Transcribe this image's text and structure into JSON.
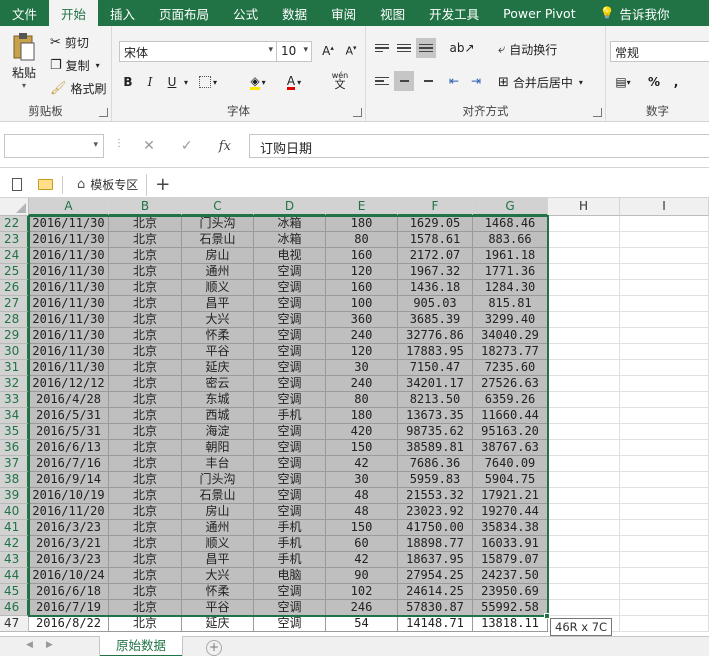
{
  "tabs": [
    {
      "label": "文件"
    },
    {
      "label": "开始",
      "active": true
    },
    {
      "label": "插入"
    },
    {
      "label": "页面布局"
    },
    {
      "label": "公式"
    },
    {
      "label": "数据"
    },
    {
      "label": "审阅"
    },
    {
      "label": "视图"
    },
    {
      "label": "开发工具"
    },
    {
      "label": "Power Pivot"
    },
    {
      "label": "告诉我你"
    }
  ],
  "ribbon": {
    "clipboard": {
      "paste": "粘贴",
      "cut": "剪切",
      "copy": "复制",
      "format_painter": "格式刷",
      "label": "剪贴板"
    },
    "font": {
      "name": "宋体",
      "size": "10",
      "bold": "B",
      "italic": "I",
      "underline": "U",
      "phonetic": "wén",
      "label": "字体"
    },
    "alignment": {
      "wrap": "自动换行",
      "merge": "合并后居中",
      "label": "对齐方式"
    },
    "number": {
      "format": "常规",
      "percent": "%",
      "comma": ",",
      "label": "数字"
    }
  },
  "formula_bar": {
    "name_box": "",
    "content": "订购日期"
  },
  "template_bar": {
    "tab_label": "模板专区"
  },
  "columns": [
    "A",
    "B",
    "C",
    "D",
    "E",
    "F",
    "G",
    "H",
    "I"
  ],
  "rows": [
    {
      "n": "22",
      "a": "2016/11/30",
      "b": "北京",
      "c": "门头沟",
      "d": "冰箱",
      "e": "180",
      "f": "1629.05",
      "g": "1468.46"
    },
    {
      "n": "23",
      "a": "2016/11/30",
      "b": "北京",
      "c": "石景山",
      "d": "冰箱",
      "e": "80",
      "f": "1578.61",
      "g": "883.66"
    },
    {
      "n": "24",
      "a": "2016/11/30",
      "b": "北京",
      "c": "房山",
      "d": "电视",
      "e": "160",
      "f": "2172.07",
      "g": "1961.18"
    },
    {
      "n": "25",
      "a": "2016/11/30",
      "b": "北京",
      "c": "通州",
      "d": "空调",
      "e": "120",
      "f": "1967.32",
      "g": "1771.36"
    },
    {
      "n": "26",
      "a": "2016/11/30",
      "b": "北京",
      "c": "顺义",
      "d": "空调",
      "e": "160",
      "f": "1436.18",
      "g": "1284.30"
    },
    {
      "n": "27",
      "a": "2016/11/30",
      "b": "北京",
      "c": "昌平",
      "d": "空调",
      "e": "100",
      "f": "905.03",
      "g": "815.81"
    },
    {
      "n": "28",
      "a": "2016/11/30",
      "b": "北京",
      "c": "大兴",
      "d": "空调",
      "e": "360",
      "f": "3685.39",
      "g": "3299.40"
    },
    {
      "n": "29",
      "a": "2016/11/30",
      "b": "北京",
      "c": "怀柔",
      "d": "空调",
      "e": "240",
      "f": "32776.86",
      "g": "34040.29"
    },
    {
      "n": "30",
      "a": "2016/11/30",
      "b": "北京",
      "c": "平谷",
      "d": "空调",
      "e": "120",
      "f": "17883.95",
      "g": "18273.77"
    },
    {
      "n": "31",
      "a": "2016/11/30",
      "b": "北京",
      "c": "延庆",
      "d": "空调",
      "e": "30",
      "f": "7150.47",
      "g": "7235.60"
    },
    {
      "n": "32",
      "a": "2016/12/12",
      "b": "北京",
      "c": "密云",
      "d": "空调",
      "e": "240",
      "f": "34201.17",
      "g": "27526.63"
    },
    {
      "n": "33",
      "a": "2016/4/28",
      "b": "北京",
      "c": "东城",
      "d": "空调",
      "e": "80",
      "f": "8213.50",
      "g": "6359.26"
    },
    {
      "n": "34",
      "a": "2016/5/31",
      "b": "北京",
      "c": "西城",
      "d": "手机",
      "e": "180",
      "f": "13673.35",
      "g": "11660.44"
    },
    {
      "n": "35",
      "a": "2016/5/31",
      "b": "北京",
      "c": "海淀",
      "d": "空调",
      "e": "420",
      "f": "98735.62",
      "g": "95163.20"
    },
    {
      "n": "36",
      "a": "2016/6/13",
      "b": "北京",
      "c": "朝阳",
      "d": "空调",
      "e": "150",
      "f": "38589.81",
      "g": "38767.63"
    },
    {
      "n": "37",
      "a": "2016/7/16",
      "b": "北京",
      "c": "丰台",
      "d": "空调",
      "e": "42",
      "f": "7686.36",
      "g": "7640.09"
    },
    {
      "n": "38",
      "a": "2016/9/14",
      "b": "北京",
      "c": "门头沟",
      "d": "空调",
      "e": "30",
      "f": "5959.83",
      "g": "5904.75"
    },
    {
      "n": "39",
      "a": "2016/10/19",
      "b": "北京",
      "c": "石景山",
      "d": "空调",
      "e": "48",
      "f": "21553.32",
      "g": "17921.21"
    },
    {
      "n": "40",
      "a": "2016/11/20",
      "b": "北京",
      "c": "房山",
      "d": "空调",
      "e": "48",
      "f": "23023.92",
      "g": "19270.44"
    },
    {
      "n": "41",
      "a": "2016/3/23",
      "b": "北京",
      "c": "通州",
      "d": "手机",
      "e": "150",
      "f": "41750.00",
      "g": "35834.38"
    },
    {
      "n": "42",
      "a": "2016/3/21",
      "b": "北京",
      "c": "顺义",
      "d": "手机",
      "e": "60",
      "f": "18898.77",
      "g": "16033.91"
    },
    {
      "n": "43",
      "a": "2016/3/23",
      "b": "北京",
      "c": "昌平",
      "d": "手机",
      "e": "42",
      "f": "18637.95",
      "g": "15879.07"
    },
    {
      "n": "44",
      "a": "2016/10/24",
      "b": "北京",
      "c": "大兴",
      "d": "电脑",
      "e": "90",
      "f": "27954.25",
      "g": "24237.50"
    },
    {
      "n": "45",
      "a": "2016/6/18",
      "b": "北京",
      "c": "怀柔",
      "d": "空调",
      "e": "102",
      "f": "24614.25",
      "g": "23950.69"
    },
    {
      "n": "46",
      "a": "2016/7/19",
      "b": "北京",
      "c": "平谷",
      "d": "空调",
      "e": "246",
      "f": "57830.87",
      "g": "55992.58"
    },
    {
      "n": "47",
      "a": "2016/8/22",
      "b": "北京",
      "c": "延庆",
      "d": "空调",
      "e": "54",
      "f": "14148.71",
      "g": "13818.11",
      "unselected": true
    }
  ],
  "selection_tooltip": "46R x 7C",
  "sheet": {
    "name": "原始数据",
    "add_symbol": "+"
  },
  "accent_color": "#217346"
}
